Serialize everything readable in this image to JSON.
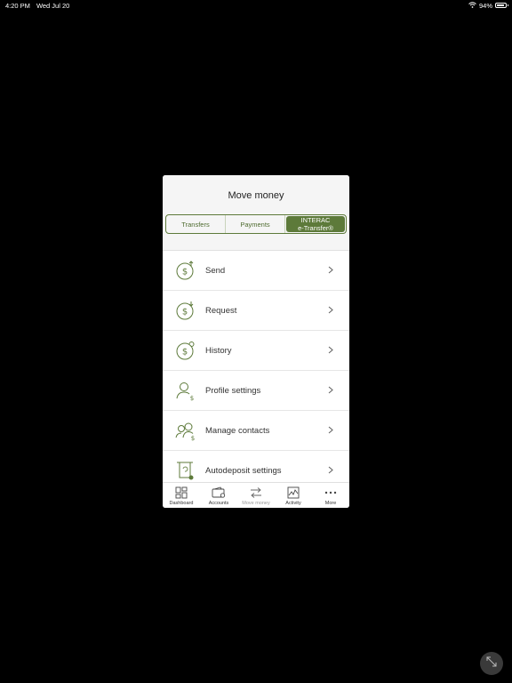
{
  "status": {
    "time": "4:20 PM",
    "date": "Wed Jul 20",
    "battery": "94%",
    "battery_level": 0.94
  },
  "header": {
    "title": "Move money"
  },
  "segments": [
    {
      "label": "Transfers"
    },
    {
      "label": "Payments"
    },
    {
      "label_line1": "INTERAC",
      "label_line2": "e-Transfer®"
    }
  ],
  "list": [
    {
      "label": "Send",
      "icon": "dollar-send-icon"
    },
    {
      "label": "Request",
      "icon": "dollar-request-icon"
    },
    {
      "label": "History",
      "icon": "dollar-history-icon"
    },
    {
      "label": "Profile settings",
      "icon": "profile-dollar-icon"
    },
    {
      "label": "Manage contacts",
      "icon": "contacts-dollar-icon"
    },
    {
      "label": "Autodeposit settings",
      "icon": "autodeposit-icon"
    }
  ],
  "tabbar": [
    {
      "label": "Dashboard",
      "icon": "dashboard-icon"
    },
    {
      "label": "Accounts",
      "icon": "wallet-icon"
    },
    {
      "label": "Move money",
      "icon": "transfer-arrows-icon"
    },
    {
      "label": "Activity",
      "icon": "activity-chart-icon"
    },
    {
      "label": "More",
      "icon": "more-dots-icon"
    }
  ],
  "colors": {
    "accent": "#5d7a3a",
    "background": "#000000",
    "panel": "#f5f5f5"
  }
}
